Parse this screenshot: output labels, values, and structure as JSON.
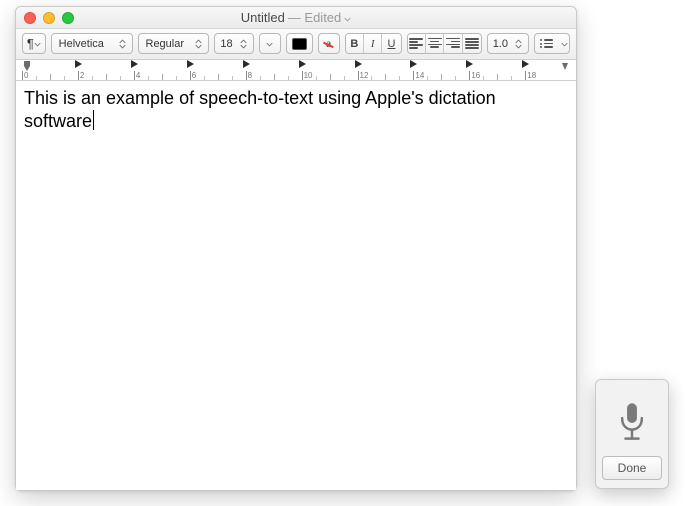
{
  "window": {
    "title": "Untitled",
    "status": "— Edited"
  },
  "toolbar": {
    "styles_label": "¶",
    "font_family": "Helvetica",
    "font_style": "Regular",
    "font_size": "18",
    "bold": "B",
    "italic": "I",
    "underline": "U",
    "strike_letter": "a",
    "line_spacing": "1.0"
  },
  "ruler": {
    "labels": [
      "0",
      "2",
      "4",
      "6",
      "8",
      "10",
      "12",
      "14",
      "16",
      "18"
    ]
  },
  "document": {
    "text": "This is an example of speech-to-text using Apple's dictation software"
  },
  "dictation": {
    "done_label": "Done"
  }
}
